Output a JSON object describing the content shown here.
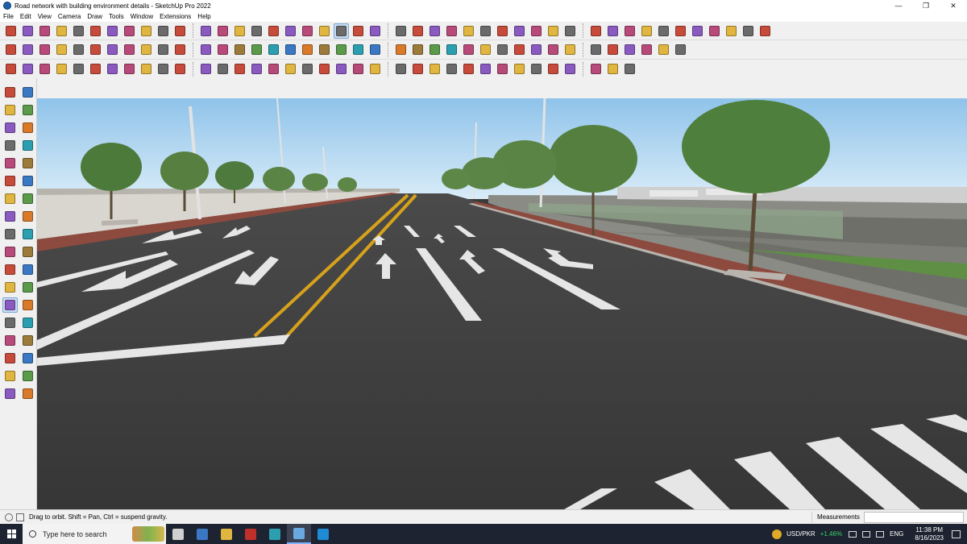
{
  "window": {
    "title": "Road network with building environment details - SketchUp Pro 2022",
    "minimize_glyph": "—",
    "restore_glyph": "❐",
    "close_glyph": "✕"
  },
  "menubar": {
    "items": [
      "File",
      "Edit",
      "View",
      "Camera",
      "Draw",
      "Tools",
      "Window",
      "Extensions",
      "Help"
    ]
  },
  "toolbars": {
    "row1_icons": [
      "select-icon",
      "eraser-icon",
      "pencil-icon",
      "arc-icon",
      "paint-bucket-icon",
      "push-pull-icon",
      "move-icon",
      "rotate-icon",
      "scale-icon",
      "tape-measure-icon",
      "text-icon",
      "orbit-icon",
      "pan-icon",
      "zoom-icon",
      "zoom-extents-icon",
      "camera-icon",
      "section-icon",
      "walk-icon",
      "look-around-icon",
      "shadow-icon",
      "undo-icon",
      "redo-icon"
    ],
    "row2_icons": [
      "component-icon",
      "solid-icon",
      "cube-icon",
      "shape-icon",
      "fill-icon",
      "box-icon",
      "pyramid-icon",
      "house-icon",
      "sandbox-icon",
      "offset-icon",
      "follow-me-icon",
      "curve-icon",
      "material-icon"
    ],
    "row3_icons": [
      "rect-icon",
      "circle-icon",
      "polygon-icon",
      "line-icon",
      "arc-icon",
      "spline-icon",
      "extrude-icon",
      "loft-icon",
      "shell-icon",
      "fillet-icon",
      "chamfer-icon",
      "pattern-icon"
    ]
  },
  "left_toolbar": {
    "icons": [
      "select-icon",
      "component-icon",
      "paint-bucket-icon",
      "eraser-icon",
      "pencil-icon",
      "freehand-icon",
      "rectangle-icon",
      "rotated-rect-icon",
      "circle-icon",
      "polygon-icon",
      "arc-icon",
      "pie-icon",
      "move-icon",
      "push-pull-icon",
      "rotate-icon",
      "follow-me-icon",
      "scale-icon",
      "offset-icon",
      "tape-measure-icon",
      "dimension-icon",
      "protractor-icon",
      "text-icon",
      "axes-icon",
      "3d-text-icon",
      "orbit-icon",
      "pan-icon",
      "zoom-icon",
      "zoom-window-icon",
      "zoom-extents-icon",
      "previous-view-icon",
      "position-camera-icon",
      "look-around-icon",
      "walk-icon",
      "section-plane-icon",
      "sandbox-icon",
      "flip-icon"
    ]
  },
  "statusbar": {
    "hint": "Drag to orbit. Shift = Pan, Ctrl = suspend gravity.",
    "measurements_label": "Measurements",
    "measurements_value": ""
  },
  "taskbar": {
    "search_placeholder": "Type here to search",
    "apps": [
      "task-view-icon",
      "calculator-icon",
      "file-explorer-icon",
      "acrobat-icon",
      "sketchup-layout-icon",
      "sketchup-icon",
      "edge-icon"
    ],
    "ticker": "USD/PKR",
    "ticker_change": "+1.46%",
    "language": "ENG",
    "time": "11:38 PM",
    "date": "8/16/2023"
  },
  "colors": {
    "sky_top": "#8fc3ea",
    "sky_bottom": "#cfe6f6",
    "asphalt": "#3d3d3d",
    "sidewalk": "#8d4a3e",
    "center_line": "#d7a21b",
    "lane_marking": "#e6e6e6",
    "grass": "#5f8f45",
    "taskbar": "#1d2330",
    "positive": "#38d26a"
  }
}
